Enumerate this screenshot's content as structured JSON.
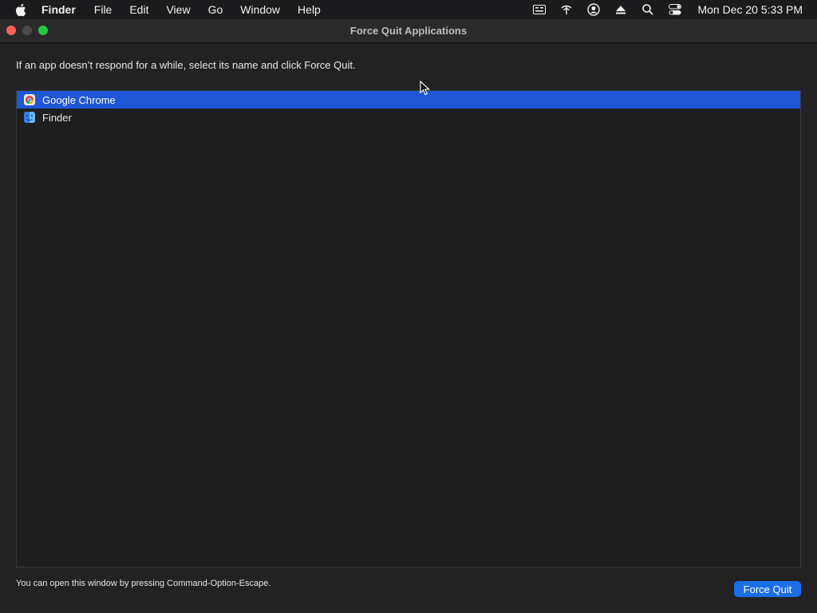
{
  "menubar": {
    "app_name": "Finder",
    "items": [
      "File",
      "Edit",
      "View",
      "Go",
      "Window",
      "Help"
    ],
    "status_icons": [
      "keyboard-icon",
      "wifi-icon",
      "user-icon",
      "eject-icon",
      "search-icon",
      "control-center-icon"
    ],
    "clock": "Mon Dec 20  5:33 PM"
  },
  "window": {
    "title": "Force Quit Applications",
    "instruction": "If an app doesn’t respond for a while, select its name and click Force Quit.",
    "apps": [
      {
        "name": "Google Chrome",
        "icon": "chrome-icon",
        "selected": true
      },
      {
        "name": "Finder",
        "icon": "finder-icon",
        "selected": false
      }
    ],
    "hint": "You can open this window by pressing Command-Option-Escape.",
    "force_quit_label": "Force Quit"
  },
  "colors": {
    "selection": "#1e56d4",
    "button": "#1a6ee8",
    "close": "#ff5f57",
    "maximize": "#28c840"
  }
}
